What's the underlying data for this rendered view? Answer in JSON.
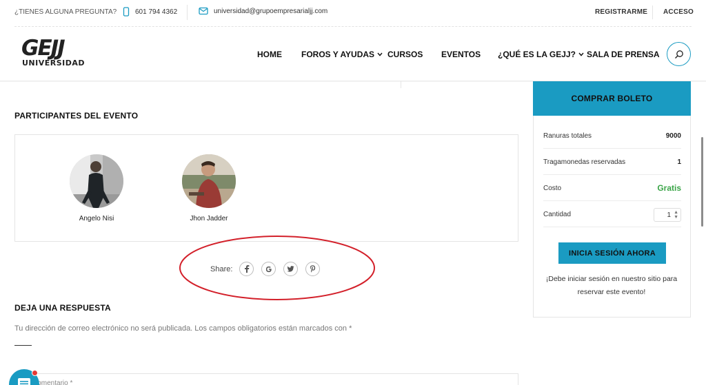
{
  "topbar": {
    "question": "¿TIENES ALGUNA PREGUNTA?",
    "phone": "601 794 4362",
    "email": "universidad@grupoempresarialjj.com",
    "register": "REGISTRARME",
    "login": "ACCESO"
  },
  "logo": {
    "mark": "GEJJ",
    "subtitle": "UNIVERSIDAD"
  },
  "nav": {
    "home": "HOME",
    "forums": "FOROS Y AYUDAS",
    "courses": "CURSOS",
    "events": "EVENTOS",
    "about": "¿QUÉ ES LA GEJJ?",
    "press": "SALA DE PRENSA"
  },
  "participants": {
    "title": "PARTICIPANTES DEL EVENTO",
    "people": [
      {
        "name": "Angelo Nisi"
      },
      {
        "name": "Jhon Jadder"
      }
    ]
  },
  "share": {
    "label": "Share:",
    "icons": [
      "facebook-icon",
      "google-icon",
      "twitter-icon",
      "pinterest-icon"
    ]
  },
  "reply": {
    "title": "DEJA UNA RESPUESTA",
    "notice": "Tu dirección de correo electrónico no será publicada. Los campos obligatorios están marcados con *",
    "comment_placeholder": "Comentario *"
  },
  "sidebar": {
    "buy_button": "COMPRAR BOLETO",
    "rows": [
      {
        "label": "Ranuras totales",
        "value": "9000"
      },
      {
        "label": "Tragamonedas reservadas",
        "value": "1"
      },
      {
        "label": "Costo",
        "value": "Gratis"
      },
      {
        "label": "Cantidad",
        "value": "1"
      }
    ],
    "login_button": "INICIA SESIÓN AHORA",
    "login_note": "¡Debe iniciar sesión en nuestro sitio para reservar este evento!"
  },
  "colors": {
    "accent": "#1a9bc2",
    "free": "#3ba548",
    "annotation": "#d3202a"
  }
}
